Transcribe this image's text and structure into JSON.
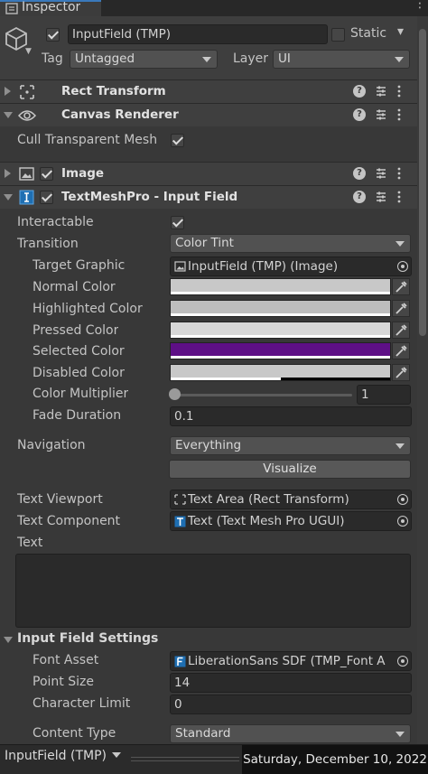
{
  "window": {
    "tab_title": "Inspector"
  },
  "object": {
    "name": "InputField (TMP)",
    "active": true,
    "static_label": "Static",
    "static_checked": false,
    "tag_label": "Tag",
    "tag_value": "Untagged",
    "layer_label": "Layer",
    "layer_value": "UI"
  },
  "components": {
    "rect_transform": {
      "title": "Rect Transform",
      "expanded": false
    },
    "canvas_renderer": {
      "title": "Canvas Renderer",
      "expanded": true,
      "cull_label": "Cull Transparent Mesh",
      "cull_checked": true
    },
    "image": {
      "title": "Image",
      "enabled": true,
      "expanded": false
    },
    "input_field": {
      "title": "TextMeshPro - Input Field",
      "enabled": true,
      "expanded": true,
      "interactable_label": "Interactable",
      "interactable_checked": true,
      "transition_label": "Transition",
      "transition_value": "Color Tint",
      "target_graphic_label": "Target Graphic",
      "target_graphic_value": "InputField (TMP) (Image)",
      "colors": [
        {
          "label": "Normal Color",
          "color": "#c8c8c8",
          "bar": "#ffffff",
          "bar_fraction": 1.0
        },
        {
          "label": "Highlighted Color",
          "color": "#bdbdbd",
          "bar": "#ffffff",
          "bar_fraction": 1.0
        },
        {
          "label": "Pressed Color",
          "color": "#d7d7d7",
          "bar": "#ffffff",
          "bar_fraction": 1.0
        },
        {
          "label": "Selected Color",
          "color": "#5e0f86",
          "bar": "#ffffff",
          "bar_fraction": 1.0
        },
        {
          "label": "Disabled Color",
          "color": "#c8c8c8",
          "bar": "#ffffff",
          "bar_fraction": 0.5
        }
      ],
      "color_multiplier_label": "Color Multiplier",
      "color_multiplier_value": "1",
      "color_multiplier_fraction": 0.0,
      "fade_duration_label": "Fade Duration",
      "fade_duration_value": "0.1",
      "navigation_label": "Navigation",
      "navigation_value": "Everything",
      "visualize_label": "Visualize",
      "text_viewport_label": "Text Viewport",
      "text_viewport_value": "Text Area (Rect Transform)",
      "text_component_label": "Text Component",
      "text_component_value": "Text (Text Mesh Pro UGUI)",
      "text_label": "Text",
      "text_value": "",
      "settings": {
        "title": "Input Field Settings",
        "font_asset_label": "Font Asset",
        "font_asset_value": "LiberationSans SDF (TMP_Font A",
        "point_size_label": "Point Size",
        "point_size_value": "14",
        "char_limit_label": "Character Limit",
        "char_limit_value": "0",
        "content_type_label": "Content Type",
        "content_type_value": "Standard"
      }
    }
  },
  "footer": {
    "selection_label": "InputField (TMP)",
    "date": "Saturday, December 10, 2022"
  },
  "icons": {
    "tab": "info-icon",
    "object": "cube-icon",
    "rect": "rect-transform-icon",
    "canvas": "eye-icon",
    "image": "image-icon",
    "input": "text-input-icon",
    "help": "help-icon",
    "presets": "presets-icon",
    "menu": "kebab-menu-icon",
    "picker": "eyedropper-icon",
    "target": "object-picker-icon"
  }
}
